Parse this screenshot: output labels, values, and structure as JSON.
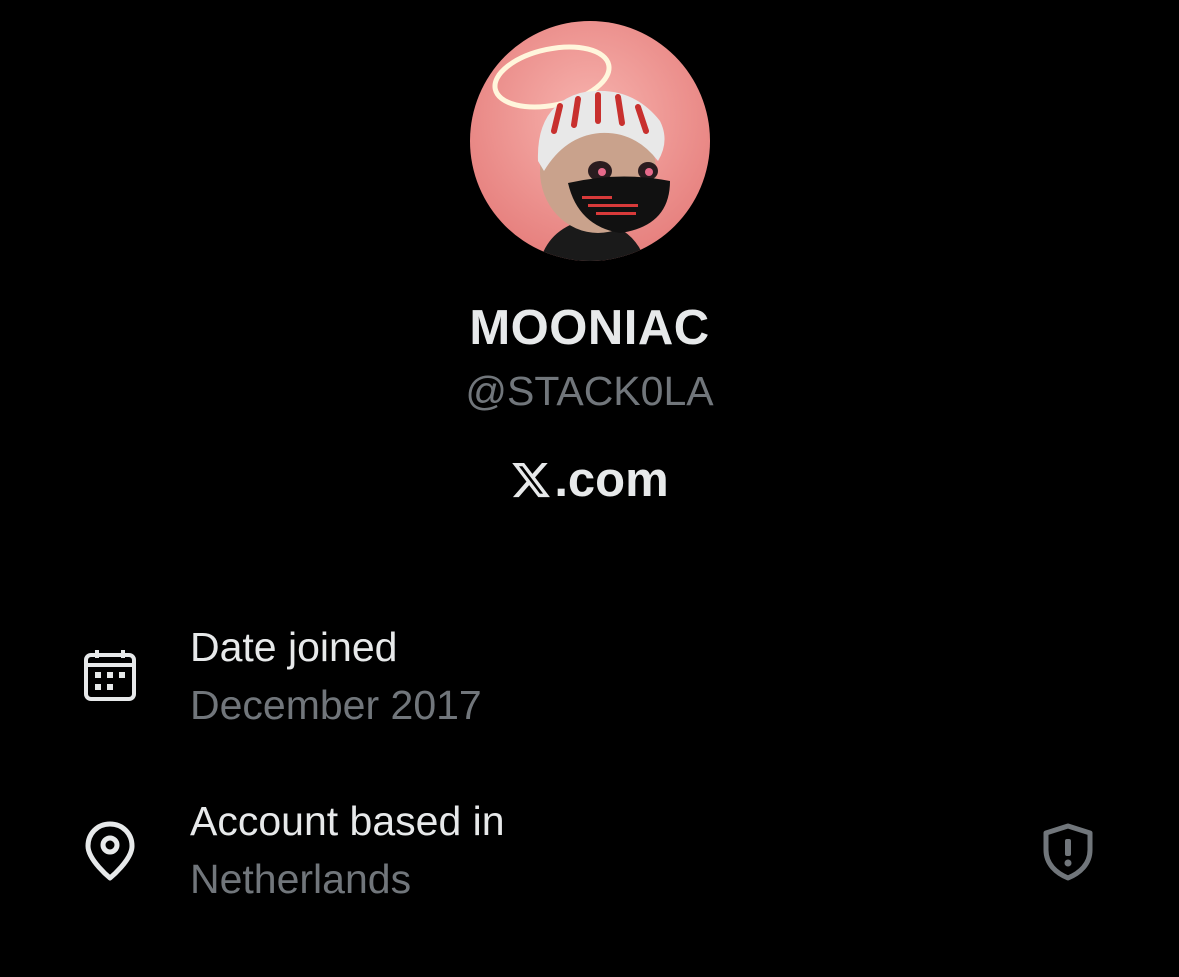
{
  "profile": {
    "display_name": "MOONIAC",
    "handle": "@STACK0LA",
    "avatar_icon": "avatar-image"
  },
  "brand": {
    "logo_icon": "x-logo-icon",
    "domain": ".com"
  },
  "details": {
    "joined": {
      "icon": "calendar-icon",
      "title": "Date joined",
      "value": "December 2017"
    },
    "location": {
      "icon": "location-pin-icon",
      "title": "Account based in",
      "value": "Netherlands",
      "badge_icon": "shield-alert-icon"
    }
  },
  "colors": {
    "background": "#000000",
    "primary_text": "#e7e9ea",
    "secondary_text": "#71767b",
    "avatar_background": "#f08f8c"
  }
}
